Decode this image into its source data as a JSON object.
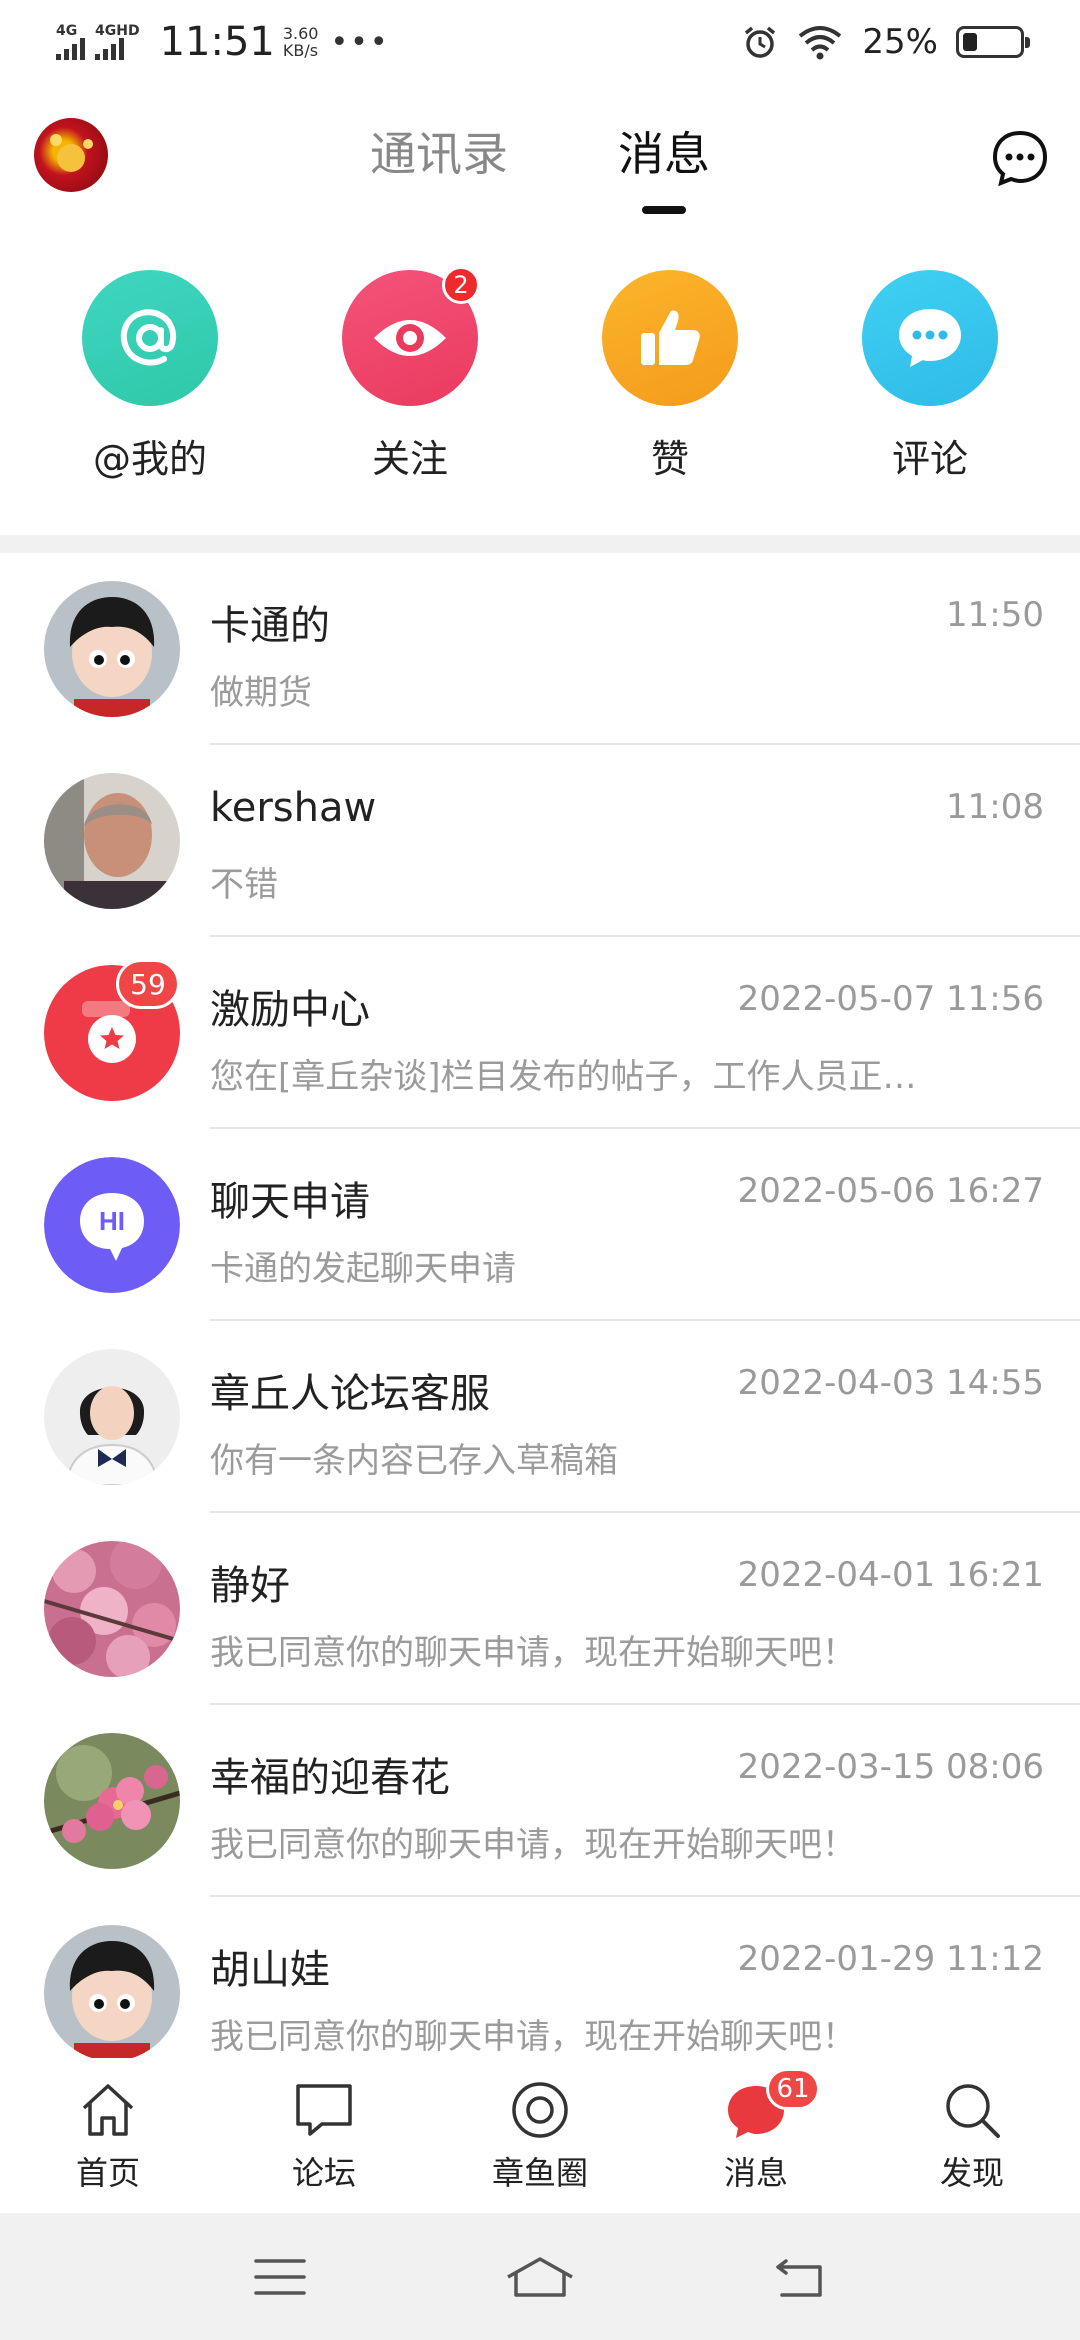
{
  "status_bar": {
    "sim1": "4G",
    "sim2": "4GHD",
    "time": "11:51",
    "speed_value": "3.60",
    "speed_unit": "KB/s",
    "more": "•••",
    "battery_percent": "25%",
    "battery_level": 0.25
  },
  "header": {
    "tabs": [
      {
        "label": "通讯录",
        "active": false
      },
      {
        "label": "消息",
        "active": true
      }
    ]
  },
  "categories": [
    {
      "label": "@我的",
      "icon": "at-icon",
      "color": "#3fd6c1"
    },
    {
      "label": "关注",
      "icon": "eye-icon",
      "color": "#f0476c",
      "badge": "2"
    },
    {
      "label": "赞",
      "icon": "thumbs-up-icon",
      "color": "#f8a825"
    },
    {
      "label": "评论",
      "icon": "comment-icon",
      "color": "#33c6ec"
    }
  ],
  "conversations": [
    {
      "name": "卡通的",
      "time": "11:50",
      "message": "做期货"
    },
    {
      "name": "kershaw",
      "time": "11:08",
      "message": "不错"
    },
    {
      "name": "激励中心",
      "time": "2022-05-07 11:56",
      "message": "您在[章丘杂谈]栏目发布的帖子，工作人员正…",
      "badge": "59"
    },
    {
      "name": "聊天申请",
      "time": "2022-05-06 16:27",
      "message": "卡通的发起聊天申请",
      "avatar_text": "HI"
    },
    {
      "name": "章丘人论坛客服",
      "time": "2022-04-03 14:55",
      "message": "你有一条内容已存入草稿箱"
    },
    {
      "name": "静好",
      "time": "2022-04-01 16:21",
      "message": "我已同意你的聊天申请，现在开始聊天吧！"
    },
    {
      "name": "幸福的迎春花",
      "time": "2022-03-15 08:06",
      "message": "我已同意你的聊天申请，现在开始聊天吧！"
    },
    {
      "name": "胡山娃",
      "time": "2022-01-29 11:12",
      "message": "我已同意你的聊天申请，现在开始聊天吧！"
    }
  ],
  "bottom_nav": [
    {
      "label": "首页",
      "icon": "home-icon"
    },
    {
      "label": "论坛",
      "icon": "forum-icon"
    },
    {
      "label": "章鱼圈",
      "icon": "circle-icon"
    },
    {
      "label": "消息",
      "icon": "message-icon",
      "badge": "61",
      "active": true
    },
    {
      "label": "发现",
      "icon": "discover-icon"
    }
  ],
  "colors": {
    "accent_red": "#ef4646",
    "text_primary": "#222222",
    "text_secondary": "#9b9b9b"
  }
}
